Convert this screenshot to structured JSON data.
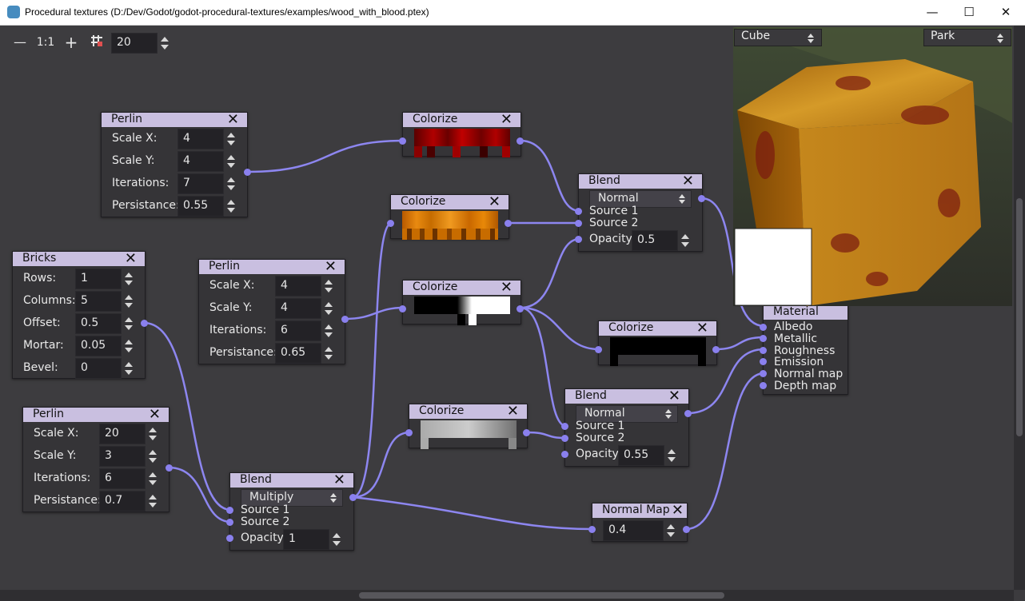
{
  "window": {
    "title": "Procedural textures (D:/Dev/Godot/godot-procedural-textures/examples/wood_with_blood.ptex)",
    "minimize_glyph": "—",
    "maximize_glyph": "☐",
    "close_glyph": "✕"
  },
  "toolbar": {
    "zoom_out_glyph": "—",
    "zoom_reset_label": "1:1",
    "zoom_in_glyph": "+",
    "snap_value": "20"
  },
  "preview": {
    "mesh": "Cube",
    "environment": "Park"
  },
  "nodes": {
    "perlin1": {
      "title": "Perlin",
      "close": "✕",
      "rows": [
        {
          "label": "Scale X:",
          "value": "4"
        },
        {
          "label": "Scale Y:",
          "value": "4"
        },
        {
          "label": "Iterations:",
          "value": "7"
        },
        {
          "label": "Persistance:",
          "value": "0.55"
        }
      ]
    },
    "bricks": {
      "title": "Bricks",
      "close": "✕",
      "rows": [
        {
          "label": "Rows:",
          "value": "1"
        },
        {
          "label": "Columns:",
          "value": "5"
        },
        {
          "label": "Offset:",
          "value": "0.5"
        },
        {
          "label": "Mortar:",
          "value": "0.05"
        },
        {
          "label": "Bevel:",
          "value": "0"
        }
      ]
    },
    "perlin2": {
      "title": "Perlin",
      "close": "✕",
      "rows": [
        {
          "label": "Scale X:",
          "value": "4"
        },
        {
          "label": "Scale Y:",
          "value": "4"
        },
        {
          "label": "Iterations:",
          "value": "6"
        },
        {
          "label": "Persistance:",
          "value": "0.65"
        }
      ]
    },
    "perlin3": {
      "title": "Perlin",
      "close": "✕",
      "rows": [
        {
          "label": "Scale X:",
          "value": "20"
        },
        {
          "label": "Scale Y:",
          "value": "3"
        },
        {
          "label": "Iterations:",
          "value": "6"
        },
        {
          "label": "Persistance:",
          "value": "0.7"
        }
      ]
    },
    "colorize1": {
      "title": "Colorize",
      "close": "✕"
    },
    "colorize2": {
      "title": "Colorize",
      "close": "✕"
    },
    "colorize3": {
      "title": "Colorize",
      "close": "✕"
    },
    "colorize4": {
      "title": "Colorize",
      "close": "✕"
    },
    "colorize5": {
      "title": "Colorize",
      "close": "✕"
    },
    "blend1": {
      "title": "Blend",
      "close": "✕",
      "mode": "Normal",
      "source1": "Source 1",
      "source2": "Source 2",
      "opacity_label": "Opacity",
      "opacity": "0.5"
    },
    "blend2": {
      "title": "Blend",
      "close": "✕",
      "mode": "Normal",
      "source1": "Source 1",
      "source2": "Source 2",
      "opacity_label": "Opacity",
      "opacity": "0.55"
    },
    "blend3": {
      "title": "Blend",
      "close": "✕",
      "mode": "Multiply",
      "source1": "Source 1",
      "source2": "Source 2",
      "opacity_label": "Opacity",
      "opacity": "1"
    },
    "normalmap": {
      "title": "Normal Map",
      "close": "✕",
      "value": "0.4"
    },
    "material": {
      "title": "Material",
      "inputs": [
        "Albedo",
        "Metallic",
        "Roughness",
        "Emission",
        "Normal map",
        "Depth map"
      ]
    }
  },
  "colors": {
    "node_header": "#c9bfe0",
    "port": "#8a80ee",
    "wire": "#8d86f0",
    "canvas": "#3d3c3f"
  }
}
